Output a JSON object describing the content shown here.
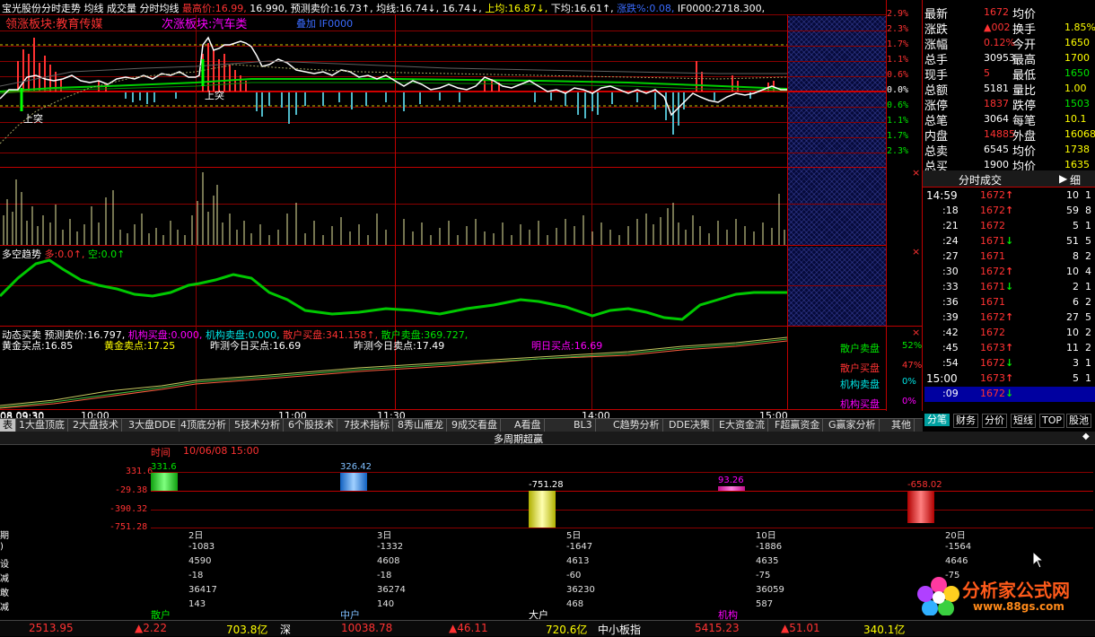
{
  "header": {
    "stock_name": "宝光股份",
    "chart_title": "分时走势",
    "avg_line_label": "均线",
    "volume_label": "成交量",
    "min_avg_label": "分时均线",
    "max_price_label": "最高价:",
    "max_price_value": "16.99,",
    "price2": "16.990,",
    "forecast_label": "预测卖价:",
    "forecast_value": "16.73↑,",
    "jx_label": "均线:",
    "jx_value1": "16.74↓,",
    "jx_value2": "16.74↓,",
    "up_avg_label": "上均:",
    "up_avg_value": "16.87↓,",
    "down_avg_label": "下均:",
    "down_avg_value": "16.61↑,",
    "rise_label": "涨跌%:",
    "rise_value": "0.08,",
    "index_label": "IF0000:",
    "index_value": "2718.300,"
  },
  "subheader": {
    "lead_block": "领涨板块:教育传媒",
    "follow_block": "次涨板块:汽车类",
    "overlay": "叠加 IF0000"
  },
  "price_scale": [
    "2.9%",
    "2.3%",
    "1.7%",
    "1.1%",
    "0.6%",
    "0.0%",
    "0.6%",
    "1.1%",
    "1.7%",
    "2.3%"
  ],
  "price_marks": [
    "上突",
    "上突"
  ],
  "trend_panel": {
    "title": "多空趋势",
    "bull_label": "多:",
    "bull_value": "0.0↑,",
    "bear_label": "空:",
    "bear_value": "0.0↑"
  },
  "dynamic_panel": {
    "title": "动态买卖",
    "forecast_label": "预测卖价:",
    "forecast_value": "16.797,",
    "inst_buy_label": "机构买盘:",
    "inst_buy_value": "0.000,",
    "inst_sell_label": "机构卖盘:",
    "inst_sell_value": "0.000,",
    "retail_buy_label": "散户买盘:",
    "retail_buy_value": "341.158↑,",
    "retail_sell_label": "散户卖盘:",
    "retail_sell_value": "369.727,",
    "gold_buy_label": "黄金买点:",
    "gold_buy_value": "16.85",
    "gold_sell_label": "黄金卖点:",
    "gold_sell_value": "17.25",
    "yest_buy_label": "昨测今日买点:",
    "yest_buy_value": "16.69",
    "yest_sell_label": "昨测今日卖点:",
    "yest_sell_value": "17.49",
    "tomorrow_buy_label": "明日买点:",
    "tomorrow_buy_value": "16.69"
  },
  "legend_box": [
    {
      "label": "散户卖盘",
      "value": "52%",
      "color": "#00e600"
    },
    {
      "label": "散户买盘",
      "value": "47%",
      "color": "#ff3232"
    },
    {
      "label": "机构卖盘",
      "value": "0%",
      "color": "#00e5e5"
    },
    {
      "label": "机构买盘",
      "value": "0%",
      "color": "#ff00ff"
    }
  ],
  "time_axis": [
    "08 09:30",
    "10:00",
    "11:00",
    "11:30",
    "14:00",
    "15:00"
  ],
  "quote": {
    "rows": [
      {
        "l1": "最新",
        "v1": "1672",
        "l2": "均价",
        "v2": ""
      },
      {
        "l1": "涨跌",
        "v1": "▲002",
        "l2": "换手",
        "v2": "1.85%"
      },
      {
        "l1": "涨幅",
        "v1": "0.12%",
        "l2": "今开",
        "v2": "1650"
      },
      {
        "l1": "总手",
        "v1": "30953",
        "l2": "最高",
        "v2": "1700"
      },
      {
        "l1": "现手",
        "v1": "5",
        "l2": "最低",
        "v2": "1650"
      },
      {
        "l1": "总额",
        "v1": "5181",
        "l2": "量比",
        "v2": "1.00"
      },
      {
        "l1": "涨停",
        "v1": "1837",
        "l2": "跌停",
        "v2": "1503"
      },
      {
        "l1": "总笔",
        "v1": "3064",
        "l2": "每笔",
        "v2": "10.1"
      },
      {
        "l1": "内盘",
        "v1": "14885",
        "l2": "外盘",
        "v2": "16068"
      },
      {
        "l1": "总卖",
        "v1": "6545",
        "l2": "均价",
        "v2": "1738"
      },
      {
        "l1": "总买",
        "v1": "1900",
        "l2": "均价",
        "v2": "1635"
      }
    ]
  },
  "ticks": {
    "title": "分时成交",
    "detail": "细",
    "rows": [
      {
        "time": "14:59",
        "price": "1672",
        "dir": "up",
        "vol": "10",
        "n": "1"
      },
      {
        "time": ":18",
        "price": "1672",
        "dir": "up",
        "vol": "59",
        "n": "8"
      },
      {
        "time": ":21",
        "price": "1672",
        "dir": "",
        "vol": "5",
        "n": "1"
      },
      {
        "time": ":24",
        "price": "1671",
        "dir": "down",
        "vol": "51",
        "n": "5"
      },
      {
        "time": ":27",
        "price": "1671",
        "dir": "",
        "vol": "8",
        "n": "2"
      },
      {
        "time": ":30",
        "price": "1672",
        "dir": "up",
        "vol": "10",
        "n": "4"
      },
      {
        "time": ":33",
        "price": "1671",
        "dir": "down",
        "vol": "2",
        "n": "1"
      },
      {
        "time": ":36",
        "price": "1671",
        "dir": "",
        "vol": "6",
        "n": "2"
      },
      {
        "time": ":39",
        "price": "1672",
        "dir": "up",
        "vol": "27",
        "n": "5"
      },
      {
        "time": ":42",
        "price": "1672",
        "dir": "",
        "vol": "10",
        "n": "2"
      },
      {
        "time": ":45",
        "price": "1673",
        "dir": "up",
        "vol": "11",
        "n": "2"
      },
      {
        "time": ":54",
        "price": "1672",
        "dir": "down",
        "vol": "3",
        "n": "1"
      },
      {
        "time": "15:00",
        "price": "1673",
        "dir": "up",
        "vol": "5",
        "n": "1"
      },
      {
        "time": ":09",
        "price": "1672",
        "dir": "down",
        "vol": "",
        "n": ""
      }
    ]
  },
  "right_tabs": [
    "分笔",
    "财务",
    "分价",
    "短线",
    "TOP",
    "股池"
  ],
  "tabs": [
    "1大盘顶底",
    "2大盘技术",
    "3大盘DDE",
    "4顶底分析",
    "5技术分析",
    "6个股技术",
    "7技术指标",
    "8秀山雁龙",
    "9成交看盘",
    "A看盘",
    "BL3",
    "C趋势分析",
    "DDE决策",
    "E大资金流",
    "F超赢资金",
    "G赢家分析",
    "其他"
  ],
  "lower": {
    "title": "多周期超赢",
    "time_label": "时间",
    "time_value": "10/06/08 15:00",
    "yscale": [
      "331.6",
      "-29.38",
      "-390.32",
      "-751.28"
    ],
    "bars": [
      {
        "value": "331.6",
        "color": "#33ff33",
        "name": "散户"
      },
      {
        "value": "326.42",
        "color": "#3a9bff",
        "name": "中户"
      },
      {
        "value": "-751.28",
        "color": "#ffff66",
        "name": "大户"
      },
      {
        "value": "93.26",
        "color": "#ff33cc",
        "name": "机构"
      },
      {
        "value": "-658.02",
        "color": "#ff3232",
        "name": ""
      }
    ],
    "row_labels": [
      "期",
      ")",
      "设",
      "减",
      "敢",
      "减"
    ],
    "periods": [
      {
        "name": "2日",
        "rows": [
          "-1083",
          "4590",
          "-18",
          "36417",
          "143"
        ]
      },
      {
        "name": "3日",
        "rows": [
          "-1332",
          "4608",
          "-18",
          "36274",
          "140"
        ]
      },
      {
        "name": "5日",
        "rows": [
          "-1647",
          "4613",
          "-60",
          "36230",
          "468"
        ]
      },
      {
        "name": "10日",
        "rows": [
          "-1886",
          "4635",
          "-75",
          "36059",
          "587"
        ]
      },
      {
        "name": "20日",
        "rows": [
          "-1564",
          "4646",
          "-75",
          "",
          ""
        ]
      }
    ]
  },
  "status_bar": {
    "sh_index": "2513.95",
    "sh_change": "▲2.22",
    "sh_amount": "703.8亿",
    "sz_label": "深",
    "sz_index": "10038.78",
    "sz_change": "▲46.11",
    "sz_amount": "720.6亿",
    "sme_label": "中小板指",
    "sme_index": "5415.23",
    "sme_change": "▲51.01",
    "sme_amount": "340.1亿"
  },
  "watermark": {
    "title": "分析家公式网",
    "url": "www.88gs.com"
  }
}
